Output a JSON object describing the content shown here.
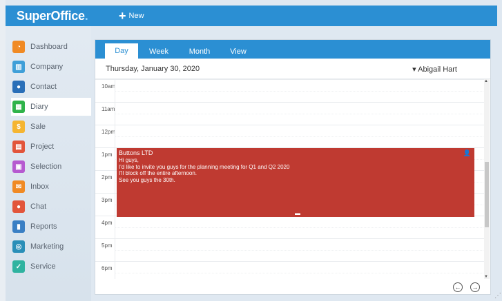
{
  "app": {
    "logo": "SuperOffice",
    "logo_dot": ".",
    "new_label": "New"
  },
  "sidebar": {
    "items": [
      {
        "label": "Dashboard",
        "icon": "dashboard-icon",
        "color": "#f08a24"
      },
      {
        "label": "Company",
        "icon": "company-icon",
        "color": "#3f9fd8"
      },
      {
        "label": "Contact",
        "icon": "contact-icon",
        "color": "#2a6fb8"
      },
      {
        "label": "Diary",
        "icon": "diary-icon",
        "color": "#2fb34a"
      },
      {
        "label": "Sale",
        "icon": "sale-icon",
        "color": "#f5b531"
      },
      {
        "label": "Project",
        "icon": "project-icon",
        "color": "#e2553b"
      },
      {
        "label": "Selection",
        "icon": "selection-icon",
        "color": "#b65ad0"
      },
      {
        "label": "Inbox",
        "icon": "inbox-icon",
        "color": "#f08a24"
      },
      {
        "label": "Chat",
        "icon": "chat-icon",
        "color": "#e2553b"
      },
      {
        "label": "Reports",
        "icon": "reports-icon",
        "color": "#3a7fc4"
      },
      {
        "label": "Marketing",
        "icon": "marketing-icon",
        "color": "#2a8fb8"
      },
      {
        "label": "Service",
        "icon": "service-icon",
        "color": "#2fb3a0"
      }
    ],
    "active": "Diary"
  },
  "tabs": [
    {
      "label": "Day",
      "active": true
    },
    {
      "label": "Week",
      "active": false
    },
    {
      "label": "Month",
      "active": false
    },
    {
      "label": "View",
      "active": false
    }
  ],
  "diary": {
    "date": "Thursday, January 30, 2020",
    "user": "▾ Abigail Hart",
    "hours": [
      "10am",
      "11am",
      "12pm",
      "1pm",
      "2pm",
      "3pm",
      "4pm",
      "5pm",
      "6pm"
    ],
    "appointment": {
      "title": "Buttons LTD",
      "lines": [
        "Hi guys,",
        "I'd like to invite you guys for the planning meeting for Q1 and Q2 2020",
        "I'll block off the entire afternoon.",
        "See you guys the 30th."
      ]
    }
  },
  "colors": {
    "accent": "#2b8fd3",
    "appointment": "#bf3a31"
  }
}
